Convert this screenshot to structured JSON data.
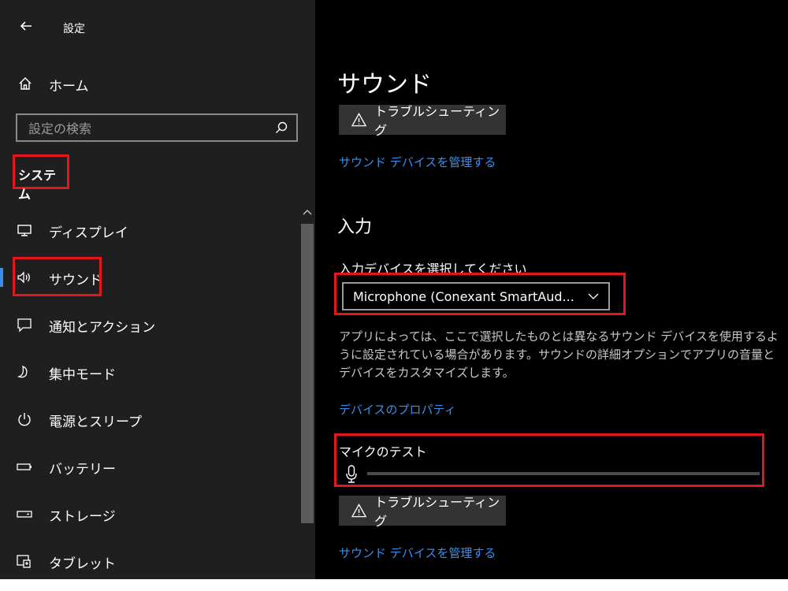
{
  "app": {
    "title": "設定"
  },
  "sidebar": {
    "home_label": "ホーム",
    "search_placeholder": "設定の検索",
    "section": "システム",
    "items": [
      {
        "label": "ディスプレイ",
        "icon": "monitor-icon"
      },
      {
        "label": "サウンド",
        "icon": "speaker-icon",
        "active": true
      },
      {
        "label": "通知とアクション",
        "icon": "notification-icon"
      },
      {
        "label": "集中モード",
        "icon": "moon-icon"
      },
      {
        "label": "電源とスリープ",
        "icon": "power-icon"
      },
      {
        "label": "バッテリー",
        "icon": "battery-icon"
      },
      {
        "label": "ストレージ",
        "icon": "storage-icon"
      },
      {
        "label": "タブレット",
        "icon": "tablet-icon"
      }
    ]
  },
  "main": {
    "title": "サウンド",
    "troubleshoot_label": "トラブルシューティング",
    "manage_devices_link": "サウンド デバイスを管理する",
    "input_heading": "入力",
    "input_device_label": "入力デバイスを選択してください",
    "input_device_value": "Microphone (Conexant SmartAud...",
    "description": "アプリによっては、ここで選択したものとは異なるサウンド デバイスを使用するように設定されている場合があります。サウンドの詳細オプションでアプリの音量とデバイスをカスタマイズします。",
    "device_properties_link": "デバイスのプロパティ",
    "mic_test_label": "マイクのテスト",
    "mic_level": 0
  },
  "colors": {
    "accent": "#3b8eea",
    "highlight_box": "#e3161c",
    "sidebar_bg": "#1f1f1f",
    "main_bg": "#000000",
    "button_bg": "#333333"
  }
}
